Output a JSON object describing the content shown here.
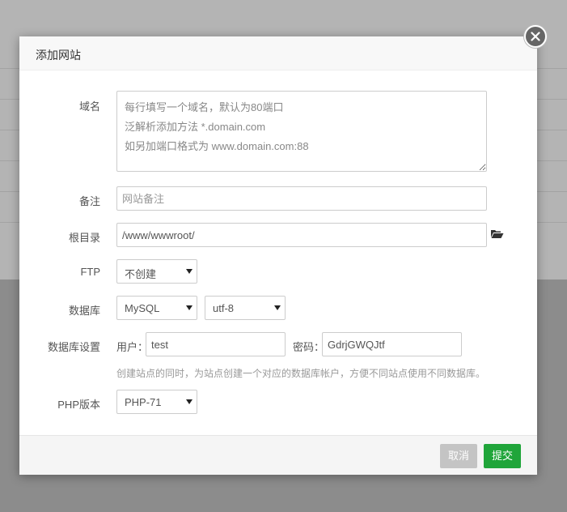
{
  "dialog": {
    "title": "添加网站",
    "fields": {
      "domain": {
        "label": "域名",
        "placeholder": "每行填写一个域名，默认为80端口\n泛解析添加方法 *.domain.com\n如另加端口格式为 www.domain.com:88",
        "value": ""
      },
      "remark": {
        "label": "备注",
        "placeholder": "网站备注",
        "value": ""
      },
      "root": {
        "label": "根目录",
        "value": "/www/wwwroot/"
      },
      "ftp": {
        "label": "FTP",
        "selected": "不创建"
      },
      "database": {
        "label": "数据库",
        "type_selected": "MySQL",
        "charset_selected": "utf-8"
      },
      "db_settings": {
        "label": "数据库设置",
        "user_label": "用户：",
        "user_value": "test",
        "password_label": "密码：",
        "password_value": "GdrjGWQJtf",
        "hint": "创建站点的同时，为站点创建一个对应的数据库帐户，方便不同站点使用不同数据库。"
      },
      "php": {
        "label": "PHP版本",
        "selected": "PHP-71"
      }
    },
    "buttons": {
      "cancel": "取消",
      "submit": "提交"
    }
  },
  "colors": {
    "accent": "#20a53a",
    "cancel": "#c4c4c4",
    "close": "#666666"
  },
  "icons": {
    "close": "close-icon",
    "folder": "folder-open-icon",
    "select_arrow": "caret-down-icon"
  }
}
